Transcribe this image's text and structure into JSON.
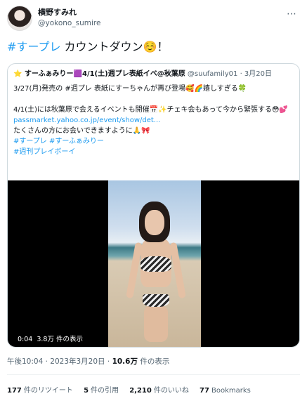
{
  "author": {
    "display_name": "横野すみれ",
    "handle": "@yokono_sumire"
  },
  "more_icon": "more-icon",
  "tweet": {
    "hashtag": "#すープレ",
    "text": " カウントダウン☺️！"
  },
  "quote": {
    "name": "⭐ すーふぁみりー🟪4/1(土)週プレ表紙イベ@秋葉原",
    "handle": "@suufamily01",
    "date": "3月20日",
    "lines": [
      "3/27(月)発売の #週プレ 表紙にすーちゃんが再び登場🥰🌈嬉しすぎる🍀",
      "",
      "4/1(土)には秋葉原で会えるイベントも開催📅✨チェキ会もあって今から緊張する😳💕",
      "passmarket.yahoo.co.jp/event/show/det...",
      "たくさんの方にお会いできますように🙏🎀",
      "#すープレ #すーふぁみりー",
      "#週刊プレイボーイ"
    ],
    "video": {
      "duration": "0:04",
      "views": "3.8万 件の表示"
    }
  },
  "meta": {
    "time_date": "午後10:04 · 2023年3月20日 · ",
    "views_count": "10.6万",
    "views_label": " 件の表示"
  },
  "stats": {
    "retweets_count": "177",
    "retweets_label": "件のリツイート",
    "quotes_count": "5",
    "quotes_label": "件の引用",
    "likes_count": "2,210",
    "likes_label": "件のいいね",
    "bookmarks_count": "77",
    "bookmarks_label": "Bookmarks"
  }
}
